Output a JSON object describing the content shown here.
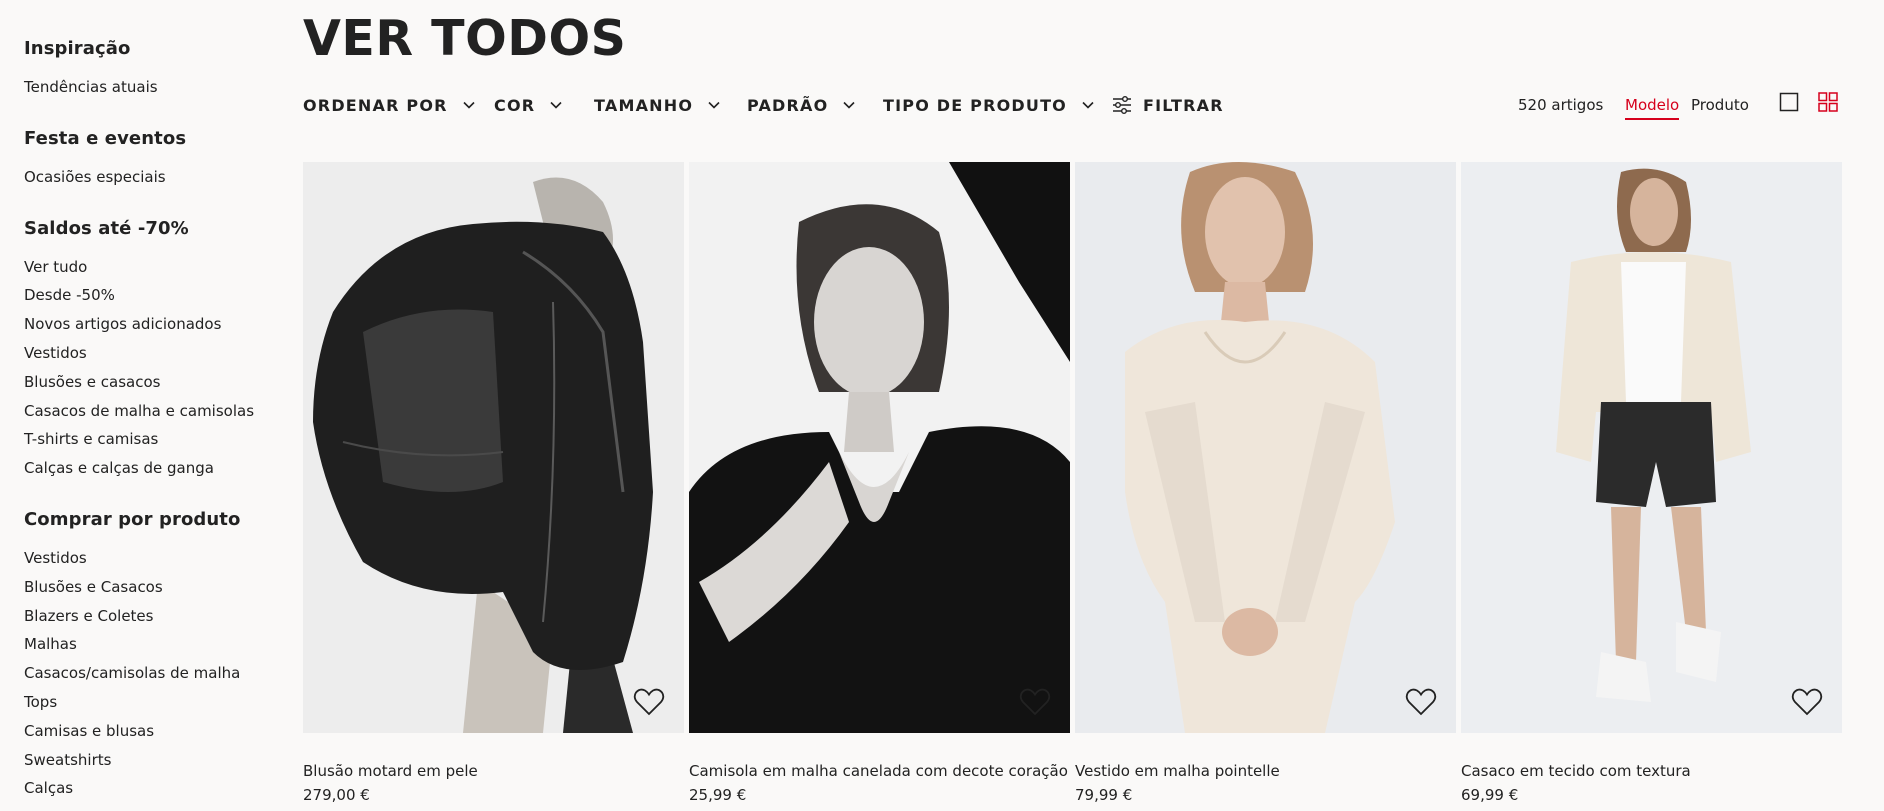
{
  "sidebar": {
    "sections": [
      {
        "heading": "Inspiração",
        "items": [
          "Tendências atuais"
        ]
      },
      {
        "heading": "Festa e eventos",
        "items": [
          "Ocasiões especiais"
        ]
      },
      {
        "heading": "Saldos até -70%",
        "items": [
          "Ver tudo",
          "Desde -50%",
          "Novos artigos adicionados",
          "Vestidos",
          "Blusões e casacos",
          "Casacos de malha e camisolas",
          "T-shirts e camisas",
          "Calças e calças de ganga"
        ]
      },
      {
        "heading": "Comprar por produto",
        "items": [
          "Vestidos",
          "Blusões e Casacos",
          "Blazers e Coletes",
          "Malhas",
          "Casacos/camisolas de malha",
          "Tops",
          "Camisas e blusas",
          "Sweatshirts",
          "Calças"
        ]
      }
    ]
  },
  "page": {
    "title": "VER TODOS"
  },
  "toolbar": {
    "sort_label": "ORDENAR POR",
    "color_label": "COR",
    "size_label": "TAMANHO",
    "pattern_label": "PADRÃO",
    "product_type_label": "TIPO DE PRODUTO",
    "filter_label": "FILTRAR",
    "count_text": "520 artigos",
    "view_model_label": "Modelo",
    "view_product_label": "Produto"
  },
  "products": [
    {
      "name": "Blusão motard em pele",
      "price": "279,00 €"
    },
    {
      "name": "Camisola em malha canelada com decote coração",
      "price": "25,99 €"
    },
    {
      "name": "Vestido em malha pointelle",
      "price": "79,99 €"
    },
    {
      "name": "Casaco em tecido com textura",
      "price": "69,99 €"
    }
  ],
  "colors": {
    "accent": "#d6001c",
    "text": "#222222",
    "background": "#faf9f8"
  },
  "icons": {
    "chevron": "chevron-down-icon",
    "filter": "sliders-icon",
    "favorite": "heart-icon",
    "single_view": "single-square-icon",
    "grid_view": "grid-four-icon"
  }
}
